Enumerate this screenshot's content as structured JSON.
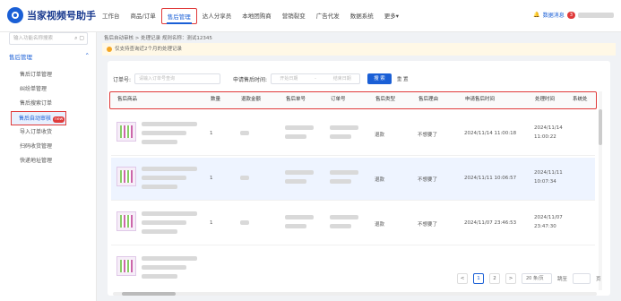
{
  "app": {
    "title": "当家视频号助手"
  },
  "nav": {
    "items": [
      "工作台",
      "商品/订单",
      "售后管理",
      "达人分享员",
      "本地团购商",
      "营销裂变",
      "广告代发",
      "数据系统",
      "更多▾"
    ],
    "active_index": 2
  },
  "topright": {
    "label": "数据消息",
    "badge": "3"
  },
  "sidebar": {
    "search_placeholder": "输入功能名称搜索",
    "group": "售后管理",
    "items": [
      {
        "label": "售后订单管理",
        "badge": ""
      },
      {
        "label": "纠纷单管理",
        "badge": ""
      },
      {
        "label": "售后搜索订单",
        "badge": ""
      },
      {
        "label": "售后自动审核",
        "badge": "new"
      },
      {
        "label": "导入订单收货",
        "badge": ""
      },
      {
        "label": "扫码收货管理",
        "badge": ""
      },
      {
        "label": "快递地址管理",
        "badge": ""
      }
    ],
    "active_index": 3
  },
  "main": {
    "breadcrumb": "售后自动审核 > 处理记录 规则名称：测试12345",
    "notice": "仅支持查询近2个月的处理记录",
    "filter": {
      "order_label": "订单号:",
      "order_placeholder": "请输入订单号查询",
      "date_label": "申请售后时间:",
      "start_placeholder": "开始日期",
      "separator": "-",
      "end_placeholder": "结束日期",
      "search_label": "搜 索",
      "reset_label": "重 置"
    },
    "columns": [
      "售后商品",
      "数量",
      "退款金额",
      "售后单号",
      "订单号",
      "售后类型",
      "售后理由",
      "申请售后时间",
      "处理时间",
      "系统处"
    ],
    "rows": [
      {
        "qty": "1",
        "type": "退款",
        "reason": "不想要了",
        "apply_time": "2024/11/14 11:00:18",
        "handle_time": [
          "2024/11/14",
          "11:00:22"
        ]
      },
      {
        "qty": "1",
        "type": "退款",
        "reason": "不想要了",
        "apply_time": "2024/11/11 10:06:57",
        "handle_time": [
          "2024/11/11",
          "10:07:34"
        ]
      },
      {
        "qty": "1",
        "type": "退款",
        "reason": "不想要了",
        "apply_time": "2024/11/07 23:46:53",
        "handle_time": [
          "2024/11/07",
          "23:47:30"
        ]
      },
      {
        "qty": "",
        "type": "",
        "reason": "",
        "apply_time": "",
        "handle_time": [
          "",
          ""
        ]
      }
    ],
    "highlighted_row": 1,
    "pager": {
      "prev": "<",
      "current": "1",
      "next2": "2",
      "next": ">",
      "size": "20 条/页",
      "goto": "跳至",
      "unit": "页"
    }
  },
  "colors": {
    "accent": "#1a5fd6",
    "highlight_border": "#e03a3a"
  }
}
